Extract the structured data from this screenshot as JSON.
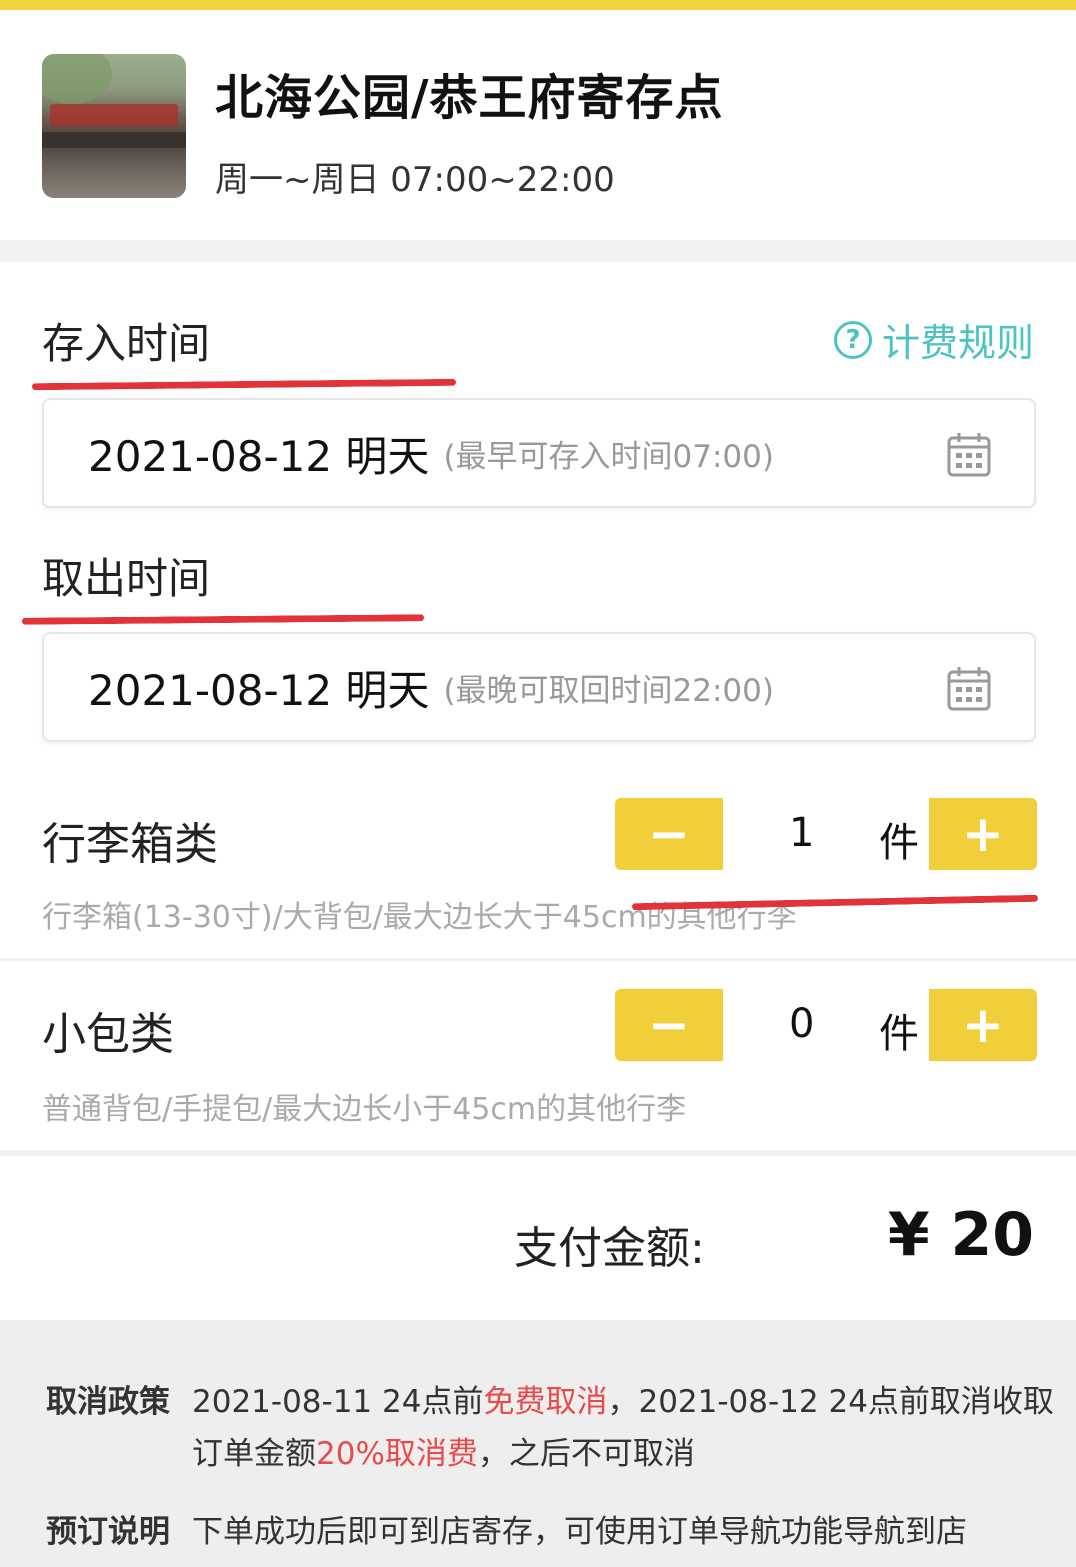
{
  "store": {
    "name": "北海公园/恭王府寄存点",
    "hours": "周一~周日 07:00~22:00"
  },
  "deposit": {
    "title": "存入时间",
    "date": "2021-08-12 明天",
    "hint": "(最早可存入时间07:00)"
  },
  "fee_rule": {
    "label": "计费规则"
  },
  "pickup": {
    "title": "取出时间",
    "date": "2021-08-12 明天",
    "hint": "(最晚可取回时间22:00)"
  },
  "luggage": {
    "title": "行李箱类",
    "desc": "行李箱(13-30寸)/大背包/最大边长大于45cm的其他行李",
    "qty": "1",
    "unit": "件",
    "minus": "−",
    "plus": "+"
  },
  "small_bag": {
    "title": "小包类",
    "desc": "普通背包/手提包/最大边长小于45cm的其他行李",
    "qty": "0",
    "unit": "件",
    "minus": "−",
    "plus": "+"
  },
  "payment": {
    "label": "支付金额:",
    "amount": "¥ 20"
  },
  "policy": {
    "cancel_label": "取消政策",
    "cancel_line1_a": "2021-08-11 24点前",
    "cancel_line1_red": "免费取消",
    "cancel_line1_b": "，2021-08-12 24点前取消收取",
    "cancel_line2_a": "订单金额",
    "cancel_line2_red": "20%取消费",
    "cancel_line2_b": "，之后不可取消",
    "booking_label": "预订说明",
    "booking_text": "下单成功后即可到店寄存，可使用订单导航功能导航到店"
  },
  "colors": {
    "accent_yellow": "#f0cf3a",
    "annotation_red": "#e2323a",
    "teal": "#4cc3c3",
    "warning_red": "#e84b4b"
  }
}
